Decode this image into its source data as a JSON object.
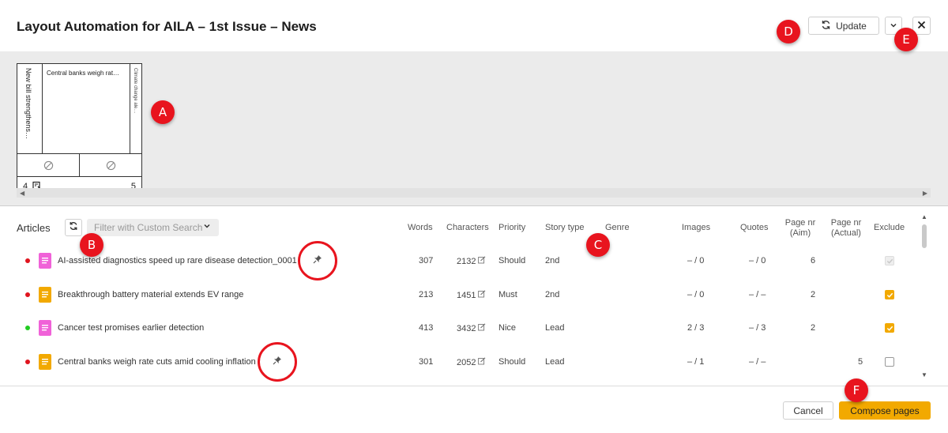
{
  "header": {
    "title": "Layout Automation for AILA – 1st Issue – News",
    "update_label": "Update"
  },
  "preview": {
    "left_story": "New bill strengthens…",
    "mid_story": "Central banks weigh rat…",
    "right_story": "Climate change ale…",
    "page_left": "4",
    "page_right": "5"
  },
  "articles": {
    "label": "Articles",
    "filter_placeholder": "Filter with Custom Search",
    "columns": {
      "words": "Words",
      "characters": "Characters",
      "priority": "Priority",
      "story_type": "Story type",
      "genre": "Genre",
      "images": "Images",
      "quotes": "Quotes",
      "page_aim_1": "Page nr",
      "page_aim_2": "(Aim)",
      "page_actual_1": "Page nr",
      "page_actual_2": "(Actual)",
      "exclude": "Exclude"
    },
    "rows": [
      {
        "name": "AI-assisted diagnostics speed up rare disease detection_0001",
        "words": "307",
        "characters": "2132",
        "priority": "Should",
        "story_type": "2nd",
        "genre": "",
        "images": "– / 0",
        "quotes": "– / 0",
        "page_aim": "6",
        "page_actual": "",
        "status_color": "#e0141e",
        "icon_color": "#f062d8",
        "exclude": "disabled"
      },
      {
        "name": "Breakthrough battery material extends EV range",
        "words": "213",
        "characters": "1451",
        "priority": "Must",
        "story_type": "2nd",
        "genre": "",
        "images": "– / 0",
        "quotes": "– / –",
        "page_aim": "2",
        "page_actual": "",
        "status_color": "#e0141e",
        "icon_color": "#f2a900",
        "exclude": "checked"
      },
      {
        "name": "Cancer test promises earlier detection",
        "words": "413",
        "characters": "3432",
        "priority": "Nice",
        "story_type": "Lead",
        "genre": "",
        "images": "2 / 3",
        "quotes": "– / 3",
        "page_aim": "2",
        "page_actual": "",
        "status_color": "#22cc22",
        "icon_color": "#f062d8",
        "exclude": "checked"
      },
      {
        "name": "Central banks weigh rate cuts amid cooling inflation",
        "words": "301",
        "characters": "2052",
        "priority": "Should",
        "story_type": "Lead",
        "genre": "",
        "images": "– / 1",
        "quotes": "– / –",
        "page_aim": "",
        "page_actual": "5",
        "status_color": "#e0141e",
        "icon_color": "#f2a900",
        "exclude": "unchecked"
      }
    ]
  },
  "footer": {
    "cancel_label": "Cancel",
    "compose_label": "Compose pages"
  },
  "markers": [
    "A",
    "B",
    "C",
    "D",
    "E",
    "F"
  ],
  "colors": {
    "accent": "#f2a900",
    "marker": "#e8141e"
  }
}
